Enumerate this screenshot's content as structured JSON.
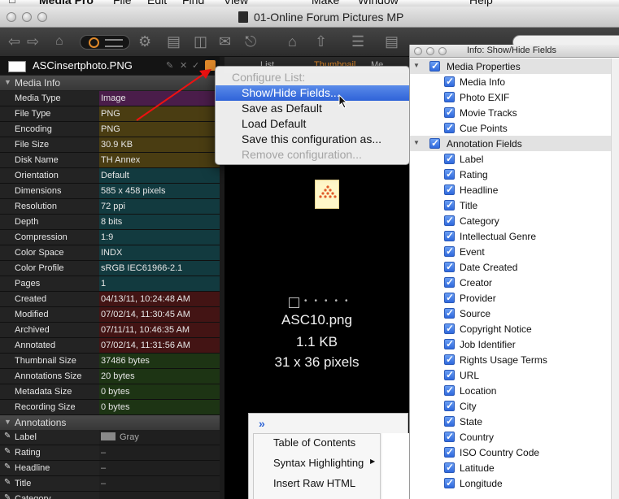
{
  "menubar": {
    "items": [
      "Media Pro",
      "File",
      "Edit",
      "Find",
      "View",
      "Make",
      "Window",
      "Help"
    ]
  },
  "window": {
    "title": "01-Online Forum Pictures MP"
  },
  "info_panel": {
    "filename": "ASCinsertphoto.PNG",
    "sections": {
      "media_info": "Media Info",
      "annotations": "Annotations"
    },
    "media_rows": [
      {
        "key": "Media Type",
        "value": "Image",
        "color": "#4a1d4a"
      },
      {
        "key": "File Type",
        "value": "PNG",
        "color": "#4a3d12"
      },
      {
        "key": "Encoding",
        "value": "PNG",
        "color": "#4a3d12"
      },
      {
        "key": "File Size",
        "value": "30.9 KB",
        "color": "#4a3d12"
      },
      {
        "key": "Disk Name",
        "value": "TH Annex",
        "color": "#4a3d12"
      },
      {
        "key": "Orientation",
        "value": "Default",
        "color": "#123a3f"
      },
      {
        "key": "Dimensions",
        "value": "585 x 458 pixels",
        "color": "#123a3f"
      },
      {
        "key": "Resolution",
        "value": "72 ppi",
        "color": "#123a3f"
      },
      {
        "key": "Depth",
        "value": "8 bits",
        "color": "#123a3f"
      },
      {
        "key": "Compression",
        "value": "1:9",
        "color": "#123a3f"
      },
      {
        "key": "Color Space",
        "value": "INDX",
        "color": "#123a3f"
      },
      {
        "key": "Color Profile",
        "value": "sRGB IEC61966-2.1",
        "color": "#123a3f"
      },
      {
        "key": "Pages",
        "value": "1",
        "color": "#123a3f"
      },
      {
        "key": "Created",
        "value": "04/13/11, 10:24:48 AM",
        "color": "#431414"
      },
      {
        "key": "Modified",
        "value": "07/02/14, 11:30:45 AM",
        "color": "#431414"
      },
      {
        "key": "Archived",
        "value": "07/11/11, 10:46:35 AM",
        "color": "#431414"
      },
      {
        "key": "Annotated",
        "value": "07/02/14, 11:31:56 AM",
        "color": "#431414"
      },
      {
        "key": "Thumbnail Size",
        "value": "37486 bytes",
        "color": "#1d3414"
      },
      {
        "key": "Annotations Size",
        "value": "20 bytes",
        "color": "#1d3414"
      },
      {
        "key": "Metadata Size",
        "value": "0 bytes",
        "color": "#1d3414"
      },
      {
        "key": "Recording Size",
        "value": "0 bytes",
        "color": "#1d3414"
      }
    ],
    "annotation_rows": [
      {
        "key": "Label",
        "value": "Gray"
      },
      {
        "key": "Rating",
        "value": "–"
      },
      {
        "key": "Headline",
        "value": "–"
      },
      {
        "key": "Title",
        "value": "–"
      },
      {
        "key": "Category",
        "value": ""
      }
    ]
  },
  "center": {
    "tabs": [
      "List",
      "Thumbnail",
      "Me"
    ],
    "caption": {
      "name": "ASC10.png",
      "size": "1.1 KB",
      "dims": "31 x 36 pixels"
    }
  },
  "configure_menu": {
    "header": "Configure List:",
    "items": [
      {
        "label": "Show/Hide Fields...",
        "state": "selected"
      },
      {
        "label": "Save as Default",
        "state": "normal"
      },
      {
        "label": "Load Default",
        "state": "normal"
      },
      {
        "label": "Save this configuration as...",
        "state": "normal"
      },
      {
        "label": "Remove configuration...",
        "state": "disabled"
      }
    ]
  },
  "lower_menu": {
    "items": [
      "Table of Contents",
      "Syntax Highlighting",
      "Insert Raw HTML"
    ]
  },
  "fields_window": {
    "title": "Info: Show/Hide Fields",
    "rows": [
      {
        "label": "Media Properties",
        "level": 0
      },
      {
        "label": "Media Info",
        "level": 1
      },
      {
        "label": "Photo EXIF",
        "level": 1
      },
      {
        "label": "Movie Tracks",
        "level": 1
      },
      {
        "label": "Cue Points",
        "level": 1
      },
      {
        "label": "Annotation Fields",
        "level": 0
      },
      {
        "label": "Label",
        "level": 1
      },
      {
        "label": "Rating",
        "level": 1
      },
      {
        "label": "Headline",
        "level": 1
      },
      {
        "label": "Title",
        "level": 1
      },
      {
        "label": "Category",
        "level": 1
      },
      {
        "label": "Intellectual Genre",
        "level": 1
      },
      {
        "label": "Event",
        "level": 1
      },
      {
        "label": "Date Created",
        "level": 1
      },
      {
        "label": "Creator",
        "level": 1
      },
      {
        "label": "Provider",
        "level": 1
      },
      {
        "label": "Source",
        "level": 1
      },
      {
        "label": "Copyright Notice",
        "level": 1
      },
      {
        "label": "Job Identifier",
        "level": 1
      },
      {
        "label": "Rights Usage Terms",
        "level": 1
      },
      {
        "label": "URL",
        "level": 1
      },
      {
        "label": "Location",
        "level": 1
      },
      {
        "label": "City",
        "level": 1
      },
      {
        "label": "State",
        "level": 1
      },
      {
        "label": "Country",
        "level": 1
      },
      {
        "label": "ISO Country Code",
        "level": 1
      },
      {
        "label": "Latitude",
        "level": 1
      },
      {
        "label": "Longitude",
        "level": 1
      }
    ]
  }
}
